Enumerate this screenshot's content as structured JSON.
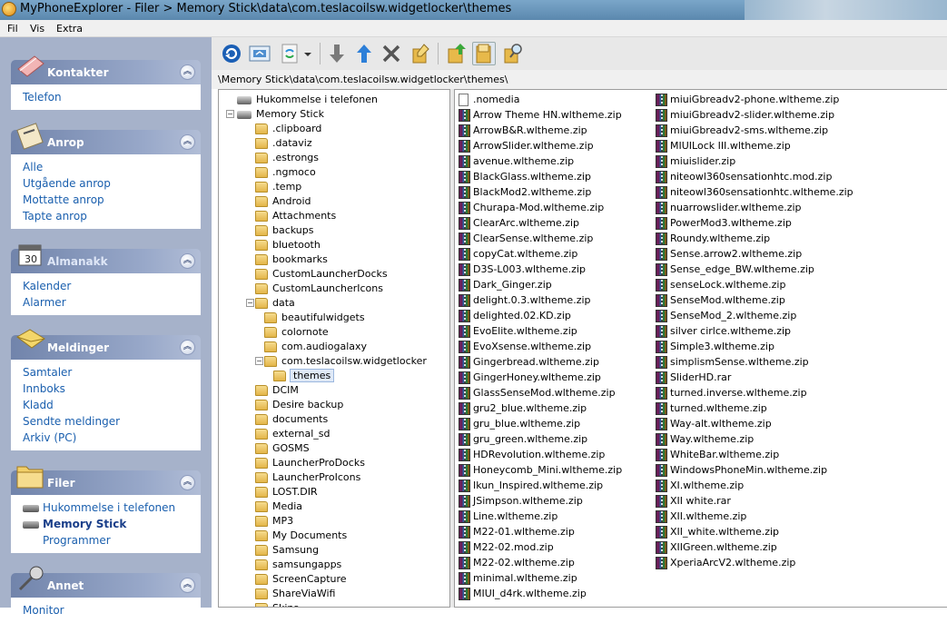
{
  "window": {
    "title": "MyPhoneExplorer  -  Filer > Memory Stick\\data\\com.teslacoilsw.widgetlocker\\themes"
  },
  "menu": [
    "Fil",
    "Vis",
    "Extra"
  ],
  "sidebar": {
    "groups": [
      {
        "title": "Kontakter",
        "icon": "contacts-book-icon",
        "items": [
          {
            "label": "Telefon"
          }
        ]
      },
      {
        "title": "Anrop",
        "icon": "phone-icon",
        "items": [
          {
            "label": "Alle"
          },
          {
            "label": "Utgående anrop"
          },
          {
            "label": "Mottatte anrop"
          },
          {
            "label": "Tapte anrop"
          }
        ]
      },
      {
        "title": "Almanakk",
        "icon": "calendar-icon",
        "items": [
          {
            "label": "Kalender"
          },
          {
            "label": "Alarmer"
          }
        ]
      },
      {
        "title": "Meldinger",
        "icon": "envelope-icon",
        "items": [
          {
            "label": "Samtaler"
          },
          {
            "label": "Innboks"
          },
          {
            "label": "Kladd"
          },
          {
            "label": "Sendte meldinger"
          },
          {
            "label": "Arkiv (PC)"
          }
        ]
      },
      {
        "title": "Filer",
        "icon": "folder-icon",
        "items": [
          {
            "label": "Hukommelse i telefonen",
            "icon": "drive-icon"
          },
          {
            "label": "Memory Stick",
            "icon": "drive-icon",
            "selected": true
          },
          {
            "label": "Programmer"
          }
        ]
      },
      {
        "title": "Annet",
        "icon": "microphone-icon",
        "items": [
          {
            "label": "Monitor"
          }
        ]
      }
    ]
  },
  "toolbar": {
    "buttons": [
      {
        "name": "refresh-button",
        "icon": "refresh-icon"
      },
      {
        "name": "sync-button",
        "icon": "sync-icon"
      },
      {
        "name": "transfer-button",
        "icon": "transfer-icon"
      },
      {
        "name": "transfer-dropdown-button",
        "icon": "chevron-down-icon"
      },
      {
        "name": "download-button",
        "icon": "arrow-down-icon"
      },
      {
        "name": "upload-button",
        "icon": "arrow-up-icon"
      },
      {
        "name": "delete-button",
        "icon": "delete-icon"
      },
      {
        "name": "rename-button",
        "icon": "rename-folder-icon"
      },
      {
        "name": "new-folder-button",
        "icon": "new-folder-icon"
      },
      {
        "name": "folder-view-button",
        "icon": "folder-view-icon",
        "pressed": true
      },
      {
        "name": "search-button",
        "icon": "search-folder-icon"
      }
    ]
  },
  "path": "\\Memory Stick\\data\\com.teslacoilsw.widgetlocker\\themes\\",
  "tree": [
    {
      "label": "Hukommelse i telefonen",
      "type": "drive",
      "level": 0
    },
    {
      "label": "Memory Stick",
      "type": "drive",
      "level": 0,
      "expanded": true
    },
    {
      "label": ".clipboard",
      "type": "folder",
      "level": 1
    },
    {
      "label": ".dataviz",
      "type": "folder",
      "level": 1
    },
    {
      "label": ".estrongs",
      "type": "folder",
      "level": 1
    },
    {
      "label": ".ngmoco",
      "type": "folder",
      "level": 1
    },
    {
      "label": ".temp",
      "type": "folder",
      "level": 1
    },
    {
      "label": "Android",
      "type": "folder",
      "level": 1
    },
    {
      "label": "Attachments",
      "type": "folder",
      "level": 1
    },
    {
      "label": "backups",
      "type": "folder",
      "level": 1
    },
    {
      "label": "bluetooth",
      "type": "folder",
      "level": 1
    },
    {
      "label": "bookmarks",
      "type": "folder",
      "level": 1
    },
    {
      "label": "CustomLauncherDocks",
      "type": "folder",
      "level": 1
    },
    {
      "label": "CustomLauncherIcons",
      "type": "folder",
      "level": 1
    },
    {
      "label": "data",
      "type": "folder",
      "level": 1,
      "expanded": true
    },
    {
      "label": "beautifulwidgets",
      "type": "folder",
      "level": 2
    },
    {
      "label": "colornote",
      "type": "folder",
      "level": 2
    },
    {
      "label": "com.audiogalaxy",
      "type": "folder",
      "level": 2
    },
    {
      "label": "com.teslacoilsw.widgetlocker",
      "type": "folder",
      "level": 2,
      "expanded": true
    },
    {
      "label": "themes",
      "type": "folder",
      "level": 3,
      "selected": true
    },
    {
      "label": "DCIM",
      "type": "folder",
      "level": 1
    },
    {
      "label": "Desire backup",
      "type": "folder",
      "level": 1
    },
    {
      "label": "documents",
      "type": "folder",
      "level": 1
    },
    {
      "label": "external_sd",
      "type": "folder",
      "level": 1
    },
    {
      "label": "GOSMS",
      "type": "folder",
      "level": 1
    },
    {
      "label": "LauncherProDocks",
      "type": "folder",
      "level": 1
    },
    {
      "label": "LauncherProIcons",
      "type": "folder",
      "level": 1
    },
    {
      "label": "LOST.DIR",
      "type": "folder",
      "level": 1
    },
    {
      "label": "Media",
      "type": "folder",
      "level": 1
    },
    {
      "label": "MP3",
      "type": "folder",
      "level": 1
    },
    {
      "label": "My Documents",
      "type": "folder",
      "level": 1
    },
    {
      "label": "Samsung",
      "type": "folder",
      "level": 1
    },
    {
      "label": "samsungapps",
      "type": "folder",
      "level": 1
    },
    {
      "label": "ScreenCapture",
      "type": "folder",
      "level": 1
    },
    {
      "label": "ShareViaWifi",
      "type": "folder",
      "level": 1
    },
    {
      "label": "Skins",
      "type": "folder",
      "level": 1
    }
  ],
  "files": {
    "col1": [
      ".nomedia",
      "Arrow Theme HN.wltheme.zip",
      "ArrowB&R.wltheme.zip",
      "ArrowSlider.wltheme.zip",
      "avenue.wltheme.zip",
      "BlackGlass.wltheme.zip",
      "BlackMod2.wltheme.zip",
      "Churapa-Mod.wltheme.zip",
      "ClearArc.wltheme.zip",
      "ClearSense.wltheme.zip",
      "copyCat.wltheme.zip",
      "D3S-L003.wltheme.zip",
      "Dark_Ginger.zip",
      "delight.0.3.wltheme.zip",
      "delighted.02.KD.zip",
      "EvoElite.wltheme.zip",
      "EvoXsense.wltheme.zip",
      "Gingerbread.wltheme.zip",
      "GingerHoney.wltheme.zip",
      "GlassSenseMod.wltheme.zip",
      "gru2_blue.wltheme.zip",
      "gru_blue.wltheme.zip",
      "gru_green.wltheme.zip",
      "HDRevolution.wltheme.zip",
      "Honeycomb_Mini.wltheme.zip",
      "Ikun_Inspired.wltheme.zip",
      "JSimpson.wltheme.zip",
      "Line.wltheme.zip",
      "M22-01.wltheme.zip",
      "M22-02.mod.zip",
      "M22-02.wltheme.zip",
      "minimal.wltheme.zip",
      "MIUI_d4rk.wltheme.zip"
    ],
    "col2": [
      "miuiGbreadv2-phone.wltheme.zip",
      "miuiGbreadv2-slider.wltheme.zip",
      "miuiGbreadv2-sms.wltheme.zip",
      "MIUILock III.wltheme.zip",
      "miuislider.zip",
      "niteowl360sensationhtc.mod.zip",
      "niteowl360sensationhtc.wltheme.zip",
      "nuarrowslider.wltheme.zip",
      "PowerMod3.wltheme.zip",
      "Roundy.wltheme.zip",
      "Sense.arrow2.wltheme.zip",
      "Sense_edge_BW.wltheme.zip",
      "senseLock.wltheme.zip",
      "SenseMod.wltheme.zip",
      "SenseMod_2.wltheme.zip",
      "silver cirlce.wltheme.zip",
      "Simple3.wltheme.zip",
      "simplismSense.wltheme.zip",
      "SliderHD.rar",
      "turned.inverse.wltheme.zip",
      "turned.wltheme.zip",
      "Way-alt.wltheme.zip",
      "Way.wltheme.zip",
      "WhiteBar.wltheme.zip",
      "WindowsPhoneMin.wltheme.zip",
      "XI.wltheme.zip",
      "XII white.rar",
      "XII.wltheme.zip",
      "XII_white.wltheme.zip",
      "XIIGreen.wltheme.zip",
      "XperiaArcV2.wltheme.zip"
    ]
  },
  "colors": {
    "sidebar_bg": "#a6b2ca",
    "link": "#1a5fae",
    "group_header": "#7184ab"
  }
}
